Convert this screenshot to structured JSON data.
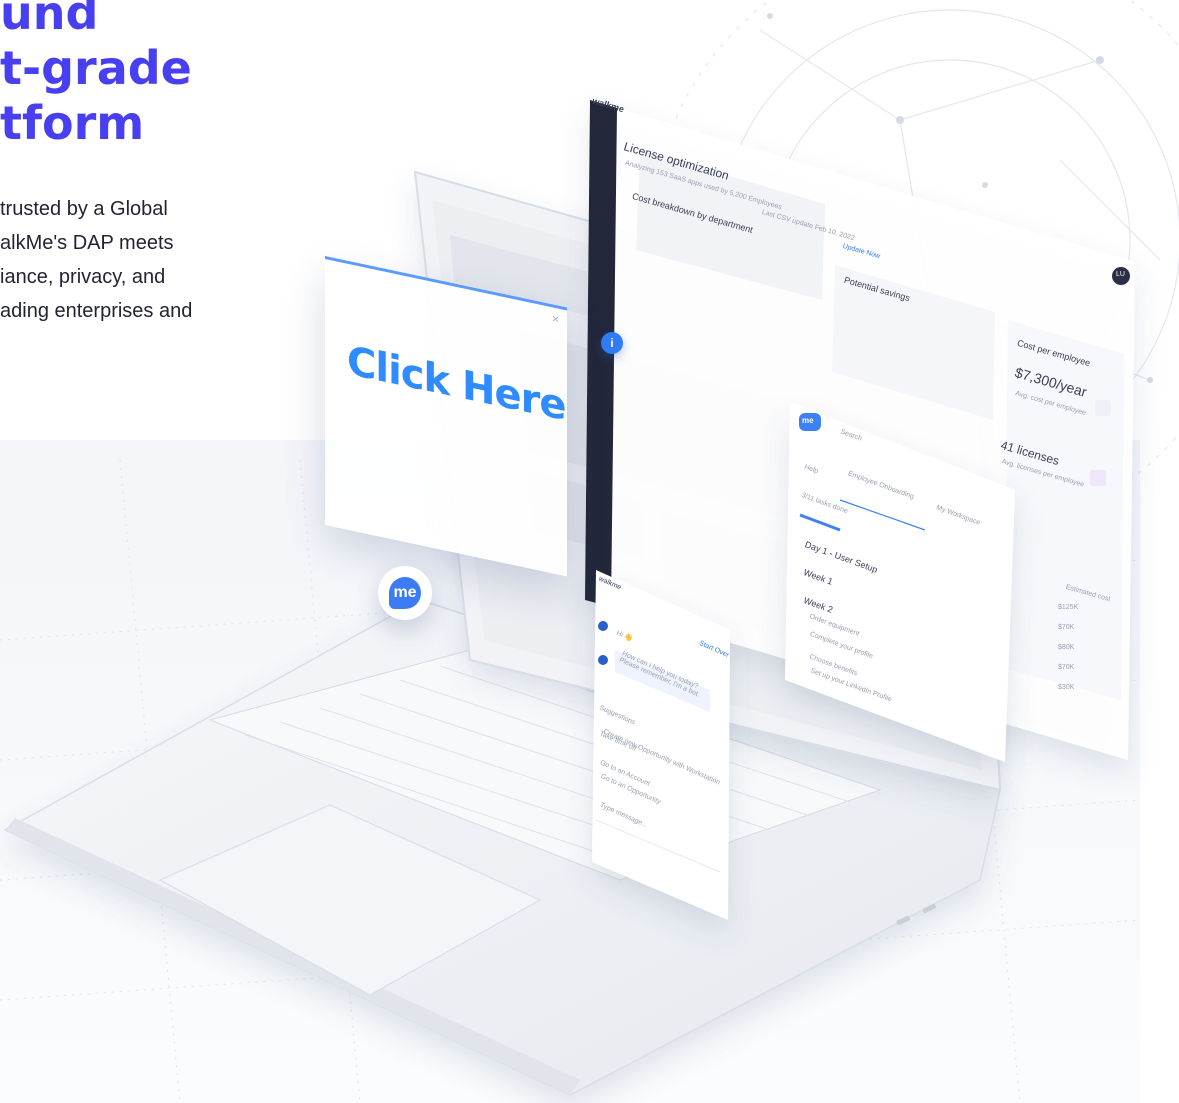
{
  "hero": {
    "title_lines": [
      "und",
      "t-grade",
      "tform"
    ],
    "body_lines": [
      "trusted by a Global",
      "alkMe's DAP meets",
      "iance, privacy, and",
      "ading enterprises and"
    ]
  },
  "colors": {
    "accent": "#4840f0",
    "brand_blue": "#2f7cf6"
  },
  "dashboard": {
    "logo": "walkme",
    "title": "License optimization",
    "subtitle": "Analyzing 153 SaaS apps used by 5,200 Employees",
    "last_update": "Last CSV update Feb 10, 2022",
    "update_link": "Update Now",
    "section": "Cost breakdown by department",
    "potential_savings": "Potential savings",
    "avatar": "LU",
    "cost_per_employee_label": "Cost per employee",
    "cost_per_employee_value": "$7,300/year",
    "cost_per_employee_sub": "Avg. cost per employee",
    "licenses_value": "41 licenses",
    "licenses_sub": "Avg. licenses per employee",
    "table_header": "Estimated cost",
    "values": [
      "$125K",
      "$70K",
      "$80K",
      "$70K",
      "$30K"
    ]
  },
  "bubble": {
    "text": "Click Here",
    "close": "×"
  },
  "info_dot": "i",
  "fab": {
    "label": "me"
  },
  "menu": {
    "logo": "me",
    "search_placeholder": "Search",
    "tab_help": "Help",
    "tab_onboarding": "Employee Onboarding",
    "tab_workspace": "My Workspace",
    "progress": "3/11 tasks done",
    "items": [
      "Day 1 - User Setup",
      "Week 1",
      "Week 2"
    ],
    "tasks": [
      "Order equipment",
      "Complete your profile",
      "Choose benefits",
      "Set up your LinkedIn Profile"
    ]
  },
  "chat": {
    "logo": "walkme",
    "greeting": "Hi 👋",
    "start_over": "Start Over",
    "question": "How can I help you today? Please remember, I'm a bot.",
    "suggestions_label": "Suggestions",
    "suggestions": [
      "Take time off",
      "Create new Opportunity with Workstation",
      "Go to an Account",
      "Go to an Opportunity"
    ],
    "input_placeholder": "Type message..."
  }
}
